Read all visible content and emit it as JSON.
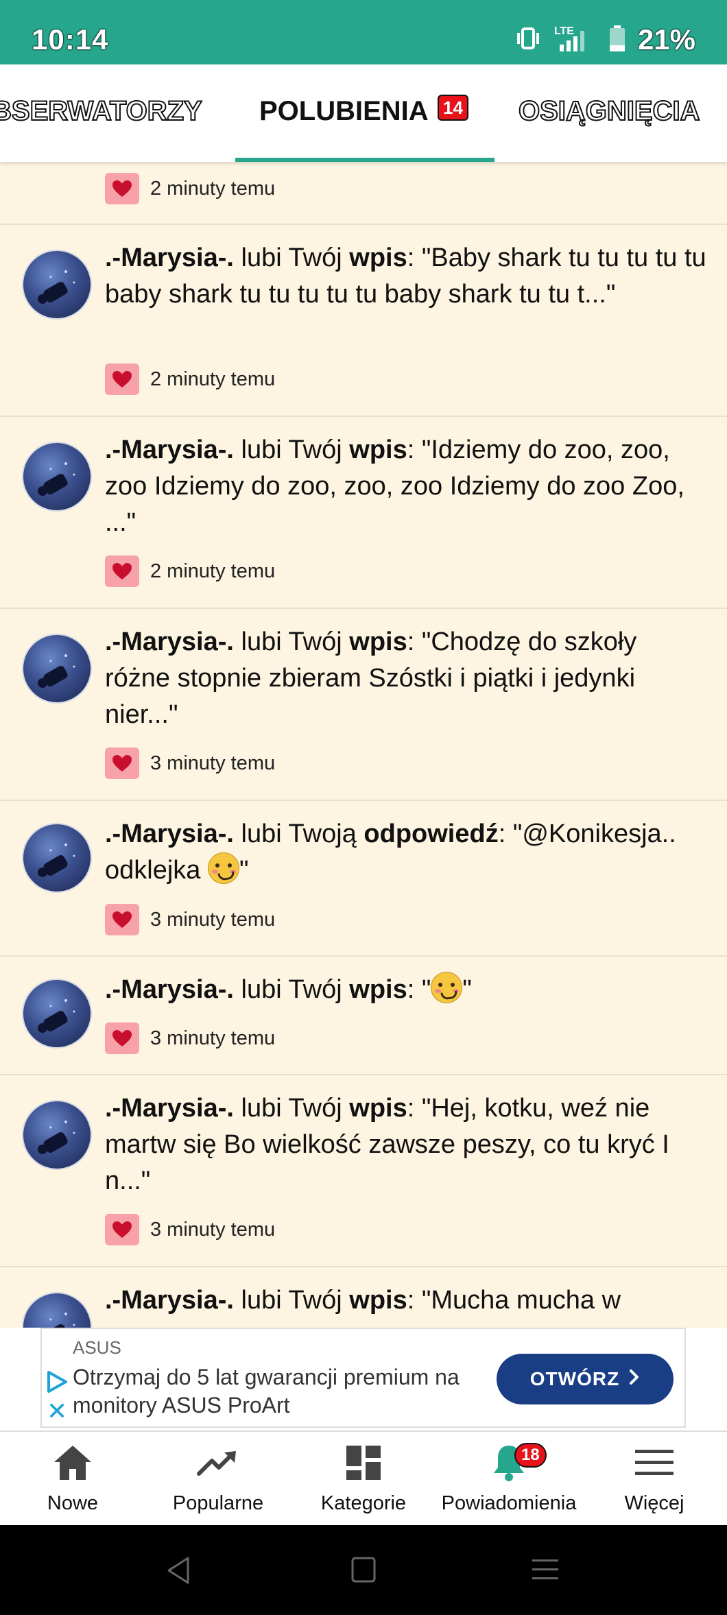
{
  "status_bar": {
    "time": "10:14",
    "network": "LTE",
    "battery": "21%"
  },
  "tabs": [
    {
      "label": "BSERWATORZY"
    },
    {
      "label": "POLUBIENIA",
      "badge": "14"
    },
    {
      "label": "OSIĄGNIĘCIA"
    }
  ],
  "notifications": [
    {
      "time": "2 minuty temu"
    },
    {
      "user": ".-Marysia-.",
      "verb": "lubi Twój",
      "object": "wpis",
      "quote": "\"Baby shark tu tu tu tu tu baby shark tu tu tu tu tu baby shark tu tu t...\"",
      "time": "2 minuty temu"
    },
    {
      "user": ".-Marysia-.",
      "verb": "lubi Twój",
      "object": "wpis",
      "quote": "\"Idziemy do zoo, zoo, zoo Idziemy do zoo, zoo, zoo Idziemy do zoo Zoo, ...\"",
      "time": "2 minuty temu"
    },
    {
      "user": ".-Marysia-.",
      "verb": "lubi Twój",
      "object": "wpis",
      "quote": "\"Chodzę do szkoły różne stopnie zbieram Szóstki i piątki i jedynki nier...\"",
      "time": "3 minuty temu"
    },
    {
      "user": ".-Marysia-.",
      "verb": "lubi Twoją",
      "object": "odpowiedź",
      "quote": "\"@Konikesja.. odklejka",
      "quote_end": "\"",
      "time": "3 minuty temu"
    },
    {
      "user": ".-Marysia-.",
      "verb": "lubi Twój",
      "object": "wpis",
      "quote": "\"",
      "quote_end": "\"",
      "time": "3 minuty temu"
    },
    {
      "user": ".-Marysia-.",
      "verb": "lubi Twój",
      "object": "wpis",
      "quote": "\"Hej, kotku, weź nie martw się Bo wielkość zawsze peszy, co tu kryć I n...\"",
      "time": "3 minuty temu"
    },
    {
      "user": ".-Marysia-.",
      "verb": "lubi Twój",
      "object": "wpis",
      "quote": "\"Mucha mucha w"
    }
  ],
  "ad": {
    "brand": "ASUS",
    "text": "Otrzymaj do 5 lat gwarancji premium na monitory ASUS ProArt",
    "button": "OTWÓRZ"
  },
  "bottom_nav": [
    {
      "label": "Nowe",
      "icon": "home-icon"
    },
    {
      "label": "Popularne",
      "icon": "trending-icon"
    },
    {
      "label": "Kategorie",
      "icon": "dashboard-icon"
    },
    {
      "label": "Powiadomienia",
      "icon": "bell-icon",
      "badge": "18"
    },
    {
      "label": "Więcej",
      "icon": "menu-icon"
    }
  ],
  "colors": {
    "accent": "#26a68c",
    "list_bg": "#fdf4e1",
    "badge": "#e8121b",
    "ad_button": "#1a3e86",
    "heart_bg": "#f7a1a8",
    "heart": "#c8102e"
  }
}
